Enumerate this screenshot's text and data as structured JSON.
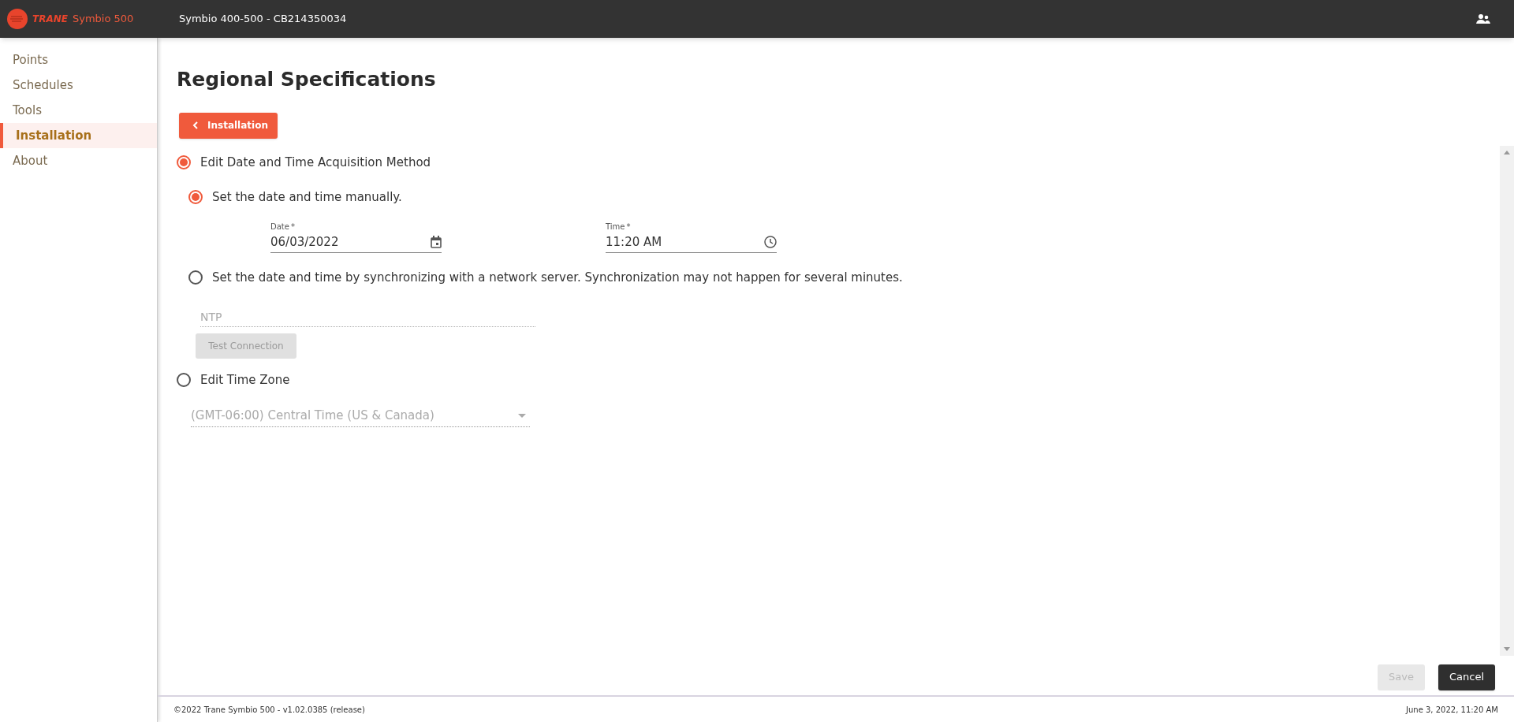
{
  "header": {
    "brand": "TRANE",
    "product": "Symbio 500",
    "device": "Symbio 400-500 - CB214350034"
  },
  "sidebar": {
    "items": [
      {
        "label": "Points",
        "selected": false
      },
      {
        "label": "Schedules",
        "selected": false
      },
      {
        "label": "Tools",
        "selected": false
      },
      {
        "label": "Installation",
        "selected": true
      },
      {
        "label": "About",
        "selected": false
      }
    ]
  },
  "page": {
    "title": "Regional Specifications",
    "back_button": "Installation"
  },
  "datetime_section": {
    "label": "Edit Date and Time Acquisition Method",
    "selected": true,
    "options": [
      {
        "label": "Set the date and time manually.",
        "selected": true
      },
      {
        "label": "Set the date and time by synchronizing with a network server. Synchronization may not happen for several minutes.",
        "selected": false
      }
    ],
    "date": {
      "label": "Date",
      "required_mark": "*",
      "value": "06/03/2022"
    },
    "time": {
      "label": "Time",
      "required_mark": "*",
      "value": "11:20 AM"
    },
    "ntp": {
      "placeholder": "NTP",
      "disabled": true
    },
    "test_button": {
      "label": "Test Connection",
      "disabled": true
    }
  },
  "timezone_section": {
    "label": "Edit Time Zone",
    "selected": false,
    "value": "(GMT-06:00) Central Time (US & Canada)",
    "disabled": true
  },
  "actions": [
    {
      "label": "Save",
      "kind": "save",
      "disabled": true
    },
    {
      "label": "Cancel",
      "kind": "cancel",
      "disabled": false
    }
  ],
  "footer": {
    "copyright": "©2022 Trane Symbio 500 - v1.02.0385 (release)",
    "timestamp": "June 3, 2022, 11:20 AM"
  }
}
